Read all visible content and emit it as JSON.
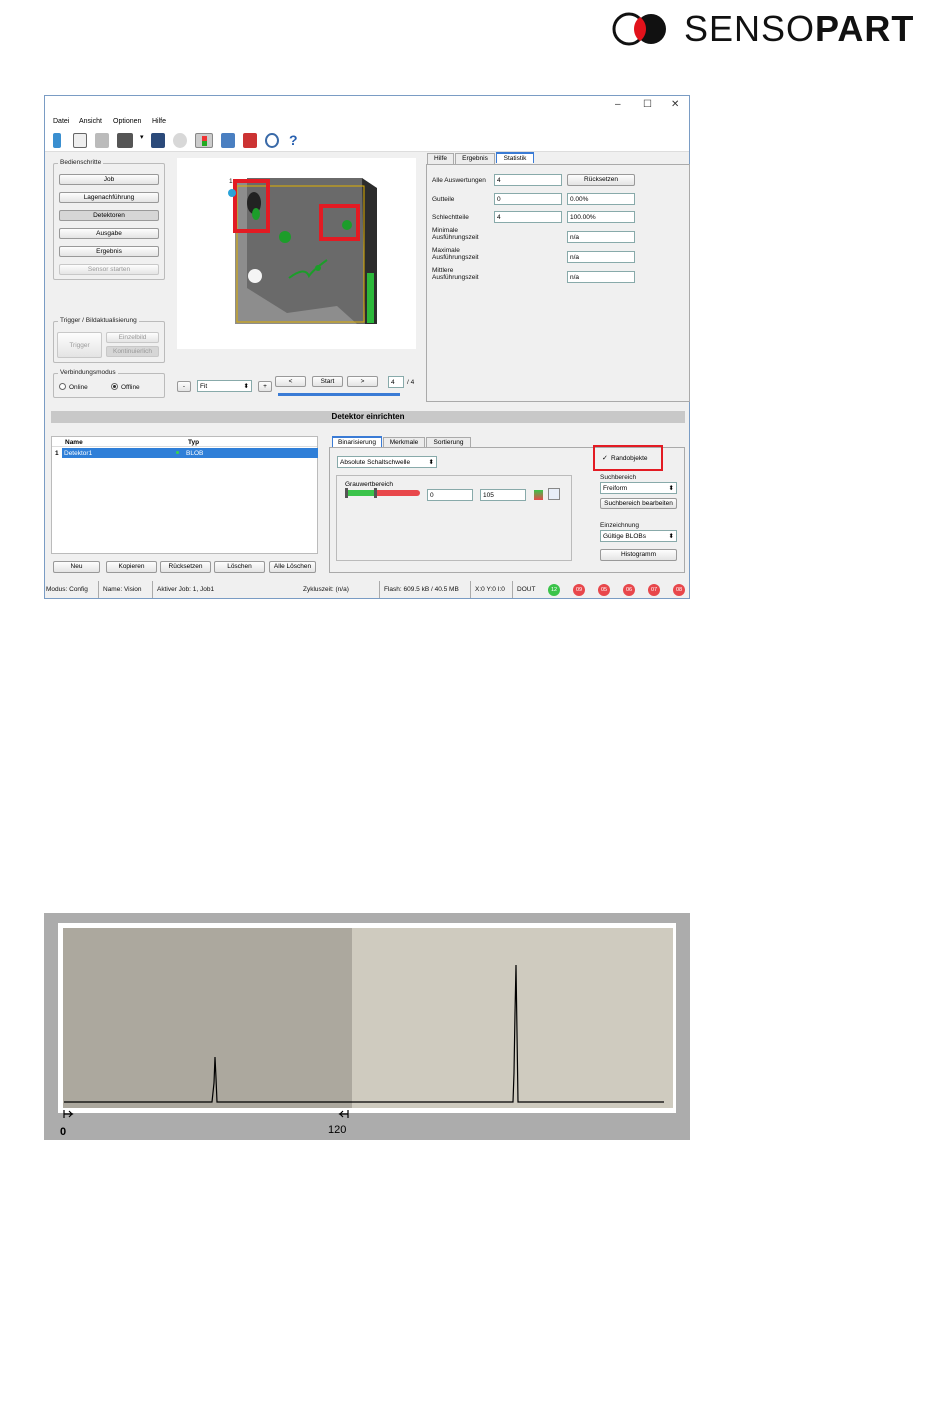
{
  "logo": {
    "text_light": "SENSO",
    "text_bold": "PART"
  },
  "window": {
    "controls": {
      "minimize": "–",
      "maximize": "☐",
      "close": "✕"
    },
    "menu": [
      "Datei",
      "Ansicht",
      "Optionen",
      "Hilfe"
    ],
    "bedienschritte": {
      "title": "Bedienschritte",
      "buttons": [
        "Job",
        "Lagenachführung",
        "Detektoren",
        "Ausgabe",
        "Ergebnis",
        "Sensor starten"
      ]
    },
    "trigger": {
      "title": "Trigger / Bildaktualisierung",
      "trigger": "Trigger",
      "einzelbild": "Einzelbild",
      "kontinuierlich": "Kontinuierlich"
    },
    "verbindung": {
      "title": "Verbindungsmodus",
      "online": "Online",
      "offline": "Offline"
    },
    "image_nav": {
      "minus": "-",
      "fit": "Fit",
      "plus": "+",
      "prev": "<",
      "start": "Start",
      "next": ">",
      "frame": "4",
      "total": "/ 4",
      "marker": "1"
    },
    "right_tabs": [
      "Hilfe",
      "Ergebnis",
      "Statistik"
    ],
    "statistik": {
      "alle_label": "Alle Auswertungen",
      "alle_value": "4",
      "reset": "Rücksetzen",
      "gut_label": "Gutteile",
      "gut_value": "0",
      "gut_pct": "0.00%",
      "schlecht_label": "Schlechtteile",
      "schlecht_value": "4",
      "schlecht_pct": "100.00%",
      "min_label_1": "Minimale",
      "min_label_2": "Ausführungszeit",
      "min_value": "n/a",
      "max_label_1": "Maximale",
      "max_label_2": "Ausführungszeit",
      "max_value": "n/a",
      "mid_label_1": "Mittlere",
      "mid_label_2": "Ausführungszeit",
      "mid_value": "n/a"
    },
    "detektor_header": "Detektor einrichten",
    "table": {
      "headers": [
        "Name",
        "Typ"
      ],
      "rows": [
        {
          "index": "1",
          "name": "Detektor1",
          "type": "BLOB"
        }
      ]
    },
    "table_buttons": [
      "Neu",
      "Kopieren",
      "Rücksetzen",
      "Löschen",
      "Alle Löschen"
    ],
    "det_tabs": [
      "Binarisierung",
      "Merkmale",
      "Sortierung"
    ],
    "binarisierung": {
      "mode": "Absolute Schaltschwelle",
      "grau_label": "Grauwertbereich",
      "low": "0",
      "high": "105",
      "randobjekte": "Randobjekte",
      "suchbereich_label": "Suchbereich",
      "suchbereich_value": "Freiform",
      "suchbereich_edit": "Suchbereich bearbeiten",
      "einzeichnung_label": "Einzeichnung",
      "einzeichnung_value": "Gültige BLOBs",
      "histogramm": "Histogramm"
    },
    "status": {
      "modus": "Modus:  Config",
      "name": "Name:  Vision",
      "job": "Aktiver Job:   1, Job1",
      "zyklus": "Zykluszeit:   (n/a)",
      "flash": "Flash:  609.5 kB / 40.5 MB",
      "xy": "X:0 Y:0 I:0",
      "dout": "DOUT",
      "leds": [
        {
          "label": "12",
          "color": "#3bc34a"
        },
        {
          "label": "09",
          "color": "#e8474b"
        },
        {
          "label": "05",
          "color": "#e8474b"
        },
        {
          "label": "06",
          "color": "#e8474b"
        },
        {
          "label": "07",
          "color": "#e8474b"
        },
        {
          "label": "08",
          "color": "#e8474b"
        }
      ]
    }
  },
  "histogram": {
    "range_start_label": "0",
    "range_end_label": "120"
  }
}
